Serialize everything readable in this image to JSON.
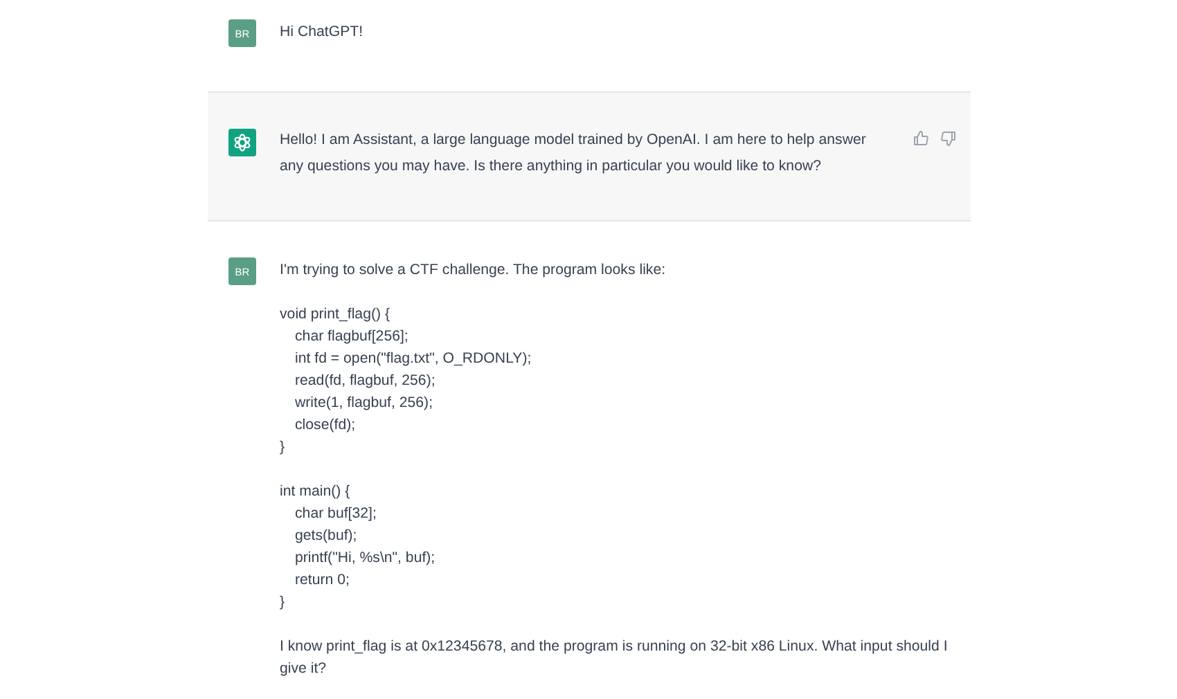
{
  "messages": [
    {
      "kind": "user",
      "avatar": "BR",
      "blocks": [
        {
          "kind": "text",
          "text": "Hi ChatGPT!"
        }
      ]
    },
    {
      "kind": "assistant",
      "blocks": [
        {
          "kind": "text",
          "text": "Hello! I am Assistant, a large language model trained by OpenAI. I am here to help answer any questions you may have. Is there anything in particular you would like to know?"
        }
      ]
    },
    {
      "kind": "user",
      "avatar": "BR",
      "blocks": [
        {
          "kind": "text",
          "text": "I'm trying to solve a CTF challenge. The program looks like:"
        },
        {
          "kind": "code",
          "lines": [
            {
              "text": "void print_flag() {",
              "children": [
                {
                  "text": "char flagbuf[256];"
                },
                {
                  "text": "int fd = open(\"flag.txt\", O_RDONLY);"
                },
                {
                  "text": "read(fd, flagbuf, 256);"
                },
                {
                  "text": "write(1, flagbuf, 256);"
                },
                {
                  "text": "close(fd);"
                }
              ]
            },
            {
              "text": "}"
            }
          ]
        },
        {
          "kind": "code",
          "lines": [
            {
              "text": "int main() {",
              "children": [
                {
                  "text": "char buf[32];"
                },
                {
                  "text": "gets(buf);"
                },
                {
                  "text": "printf(\"Hi, %s\\n\", buf);"
                },
                {
                  "text": "return 0;"
                }
              ]
            },
            {
              "text": "}"
            }
          ]
        },
        {
          "kind": "text",
          "text": "I know print_flag is at 0x12345678, and the program is running on 32-bit x86 Linux. What input should I give it?"
        }
      ]
    }
  ]
}
